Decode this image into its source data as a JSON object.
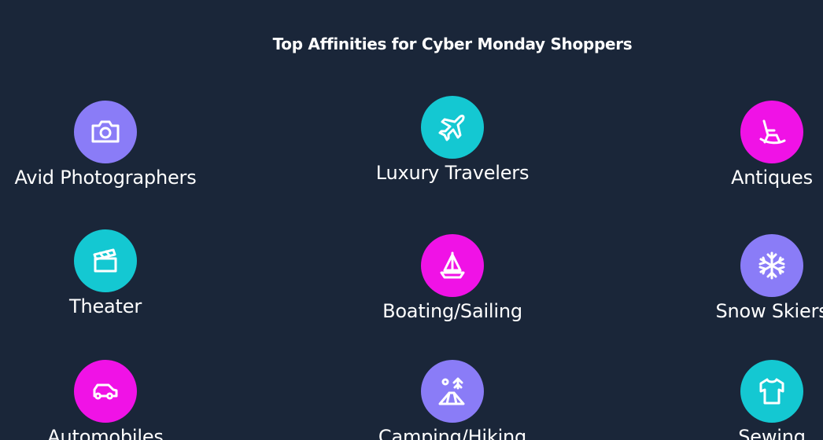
{
  "title": "Top Affinities for Cyber Monday Shoppers",
  "colors": {
    "background": "#1a2639",
    "purple": "#8a7cf7",
    "teal": "#14c8d2",
    "magenta": "#f012e6"
  },
  "affinities": [
    {
      "label": "Avid Photographers",
      "icon": "camera-icon",
      "color": "#8a7cf7"
    },
    {
      "label": "Luxury Travelers",
      "icon": "airplane-icon",
      "color": "#14c8d2"
    },
    {
      "label": "Antiques",
      "icon": "rocking-chair-icon",
      "color": "#f012e6"
    },
    {
      "label": "Theater",
      "icon": "clapperboard-icon",
      "color": "#14c8d2"
    },
    {
      "label": "Boating/Sailing",
      "icon": "sailboat-icon",
      "color": "#f012e6"
    },
    {
      "label": "Snow Skiers",
      "icon": "snowflake-icon",
      "color": "#8a7cf7"
    },
    {
      "label": "Automobiles",
      "icon": "car-icon",
      "color": "#f012e6"
    },
    {
      "label": "Camping/Hiking",
      "icon": "tent-icon",
      "color": "#8a7cf7"
    },
    {
      "label": "Sewing",
      "icon": "tshirt-icon",
      "color": "#14c8d2"
    }
  ]
}
